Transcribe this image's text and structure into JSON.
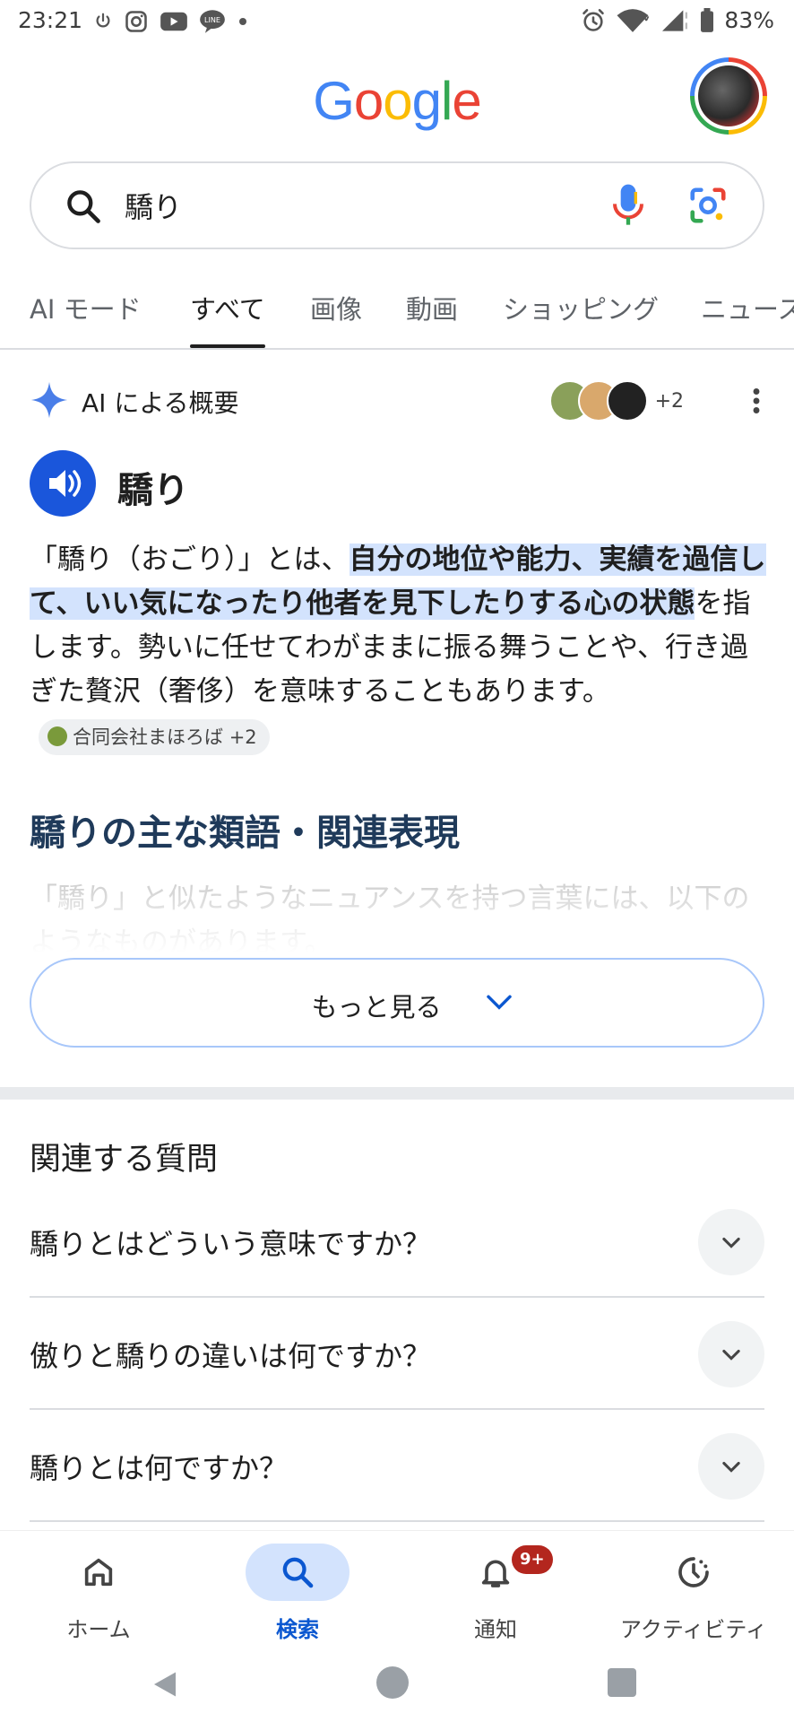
{
  "status_bar": {
    "time": "23:21",
    "battery": "83%",
    "icons": [
      "power-icon",
      "instagram-icon",
      "youtube-icon",
      "line-icon",
      "dot-icon",
      "alarm-icon",
      "wifi-icon",
      "signal-icon",
      "battery-icon"
    ]
  },
  "header": {
    "logo": [
      "G",
      "o",
      "o",
      "g",
      "l",
      "e"
    ],
    "logo_colors": [
      "#4285f4",
      "#ea4335",
      "#fbbc05",
      "#4285f4",
      "#34a853",
      "#ea4335"
    ]
  },
  "search": {
    "query": "驕り"
  },
  "tabs": [
    {
      "label": "AI モード"
    },
    {
      "label": "すべて",
      "active": true
    },
    {
      "label": "画像"
    },
    {
      "label": "動画"
    },
    {
      "label": "ショッピング"
    },
    {
      "label": "ニュース"
    }
  ],
  "ai_overview": {
    "title": "AI による概要",
    "sources_more": "+2",
    "word": "驕り",
    "body": {
      "intro": "「驕り（おごり）」とは、",
      "highlight": "自分の地位や能力、実績を過信して、いい気になったり他者を見下したりする心の状態",
      "rest": "を指します。勢いに任せてわがままに振る舞うことや、行き過ぎた贅沢（奢侈）を意味することもあります。",
      "chip": "合同会社まほろば",
      "chip_more": "+2"
    },
    "subheading": "驕りの主な類語・関連表現",
    "faded_text": "「驕り」と似たようなニュアンスを持つ言葉には、以下のようなものがあります。",
    "more_button": "もっと見る"
  },
  "related_questions": {
    "title": "関連する質問",
    "items": [
      {
        "question": "驕りとはどういう意味ですか？"
      },
      {
        "question": "傲りと驕りの違いは何ですか？"
      },
      {
        "question": "驕りとは何ですか？"
      }
    ]
  },
  "bottom_nav": [
    {
      "label": "ホーム",
      "icon": "home-icon"
    },
    {
      "label": "検索",
      "icon": "search-icon",
      "active": true
    },
    {
      "label": "通知",
      "icon": "bell-icon",
      "badge": "9+"
    },
    {
      "label": "アクティビティ",
      "icon": "activity-icon"
    }
  ],
  "colors": {
    "accent": "#0b57d0",
    "highlight": "#d3e3fd",
    "badge": "#b3261e"
  }
}
